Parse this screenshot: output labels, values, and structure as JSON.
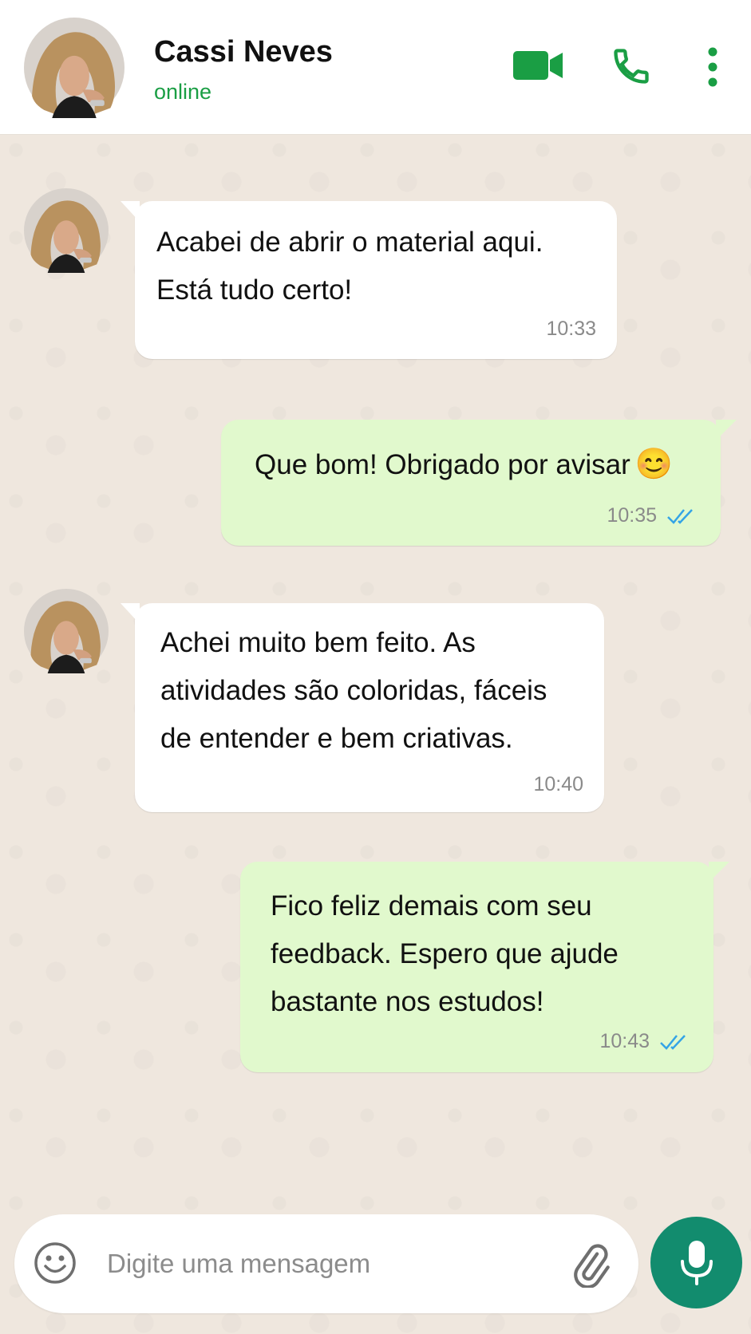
{
  "header": {
    "contact_name": "Cassi Neves",
    "status": "online",
    "accent_color": "#1a9e44",
    "icons": [
      "avatar",
      "video-call-icon",
      "voice-call-icon",
      "more-menu-icon"
    ]
  },
  "messages": [
    {
      "direction": "incoming",
      "lines": [
        "Acabei de abrir o material aqui.",
        "Está tudo certo!"
      ],
      "time": "10:33"
    },
    {
      "direction": "outgoing",
      "lines": [
        "Que bom! Obrigado por avisar"
      ],
      "emoji": "😊",
      "time": "10:35",
      "status": "read"
    },
    {
      "direction": "incoming",
      "lines": [
        "Achei muito bem feito. As",
        "atividades são coloridas, fáceis",
        "de entender e bem criativas."
      ],
      "time": "10:40"
    },
    {
      "direction": "outgoing",
      "lines": [
        "Fico feliz demais com seu",
        "feedback. Espero que ajude",
        "bastante nos estudos!"
      ],
      "time": "10:43",
      "status": "read"
    }
  ],
  "composer": {
    "placeholder": "Digite uma mensagem",
    "value": "",
    "send_button_color": "#128c6e",
    "icons": [
      "emoji-icon",
      "attach-icon",
      "mic-icon"
    ]
  },
  "colors": {
    "chat_background": "#efe7de",
    "incoming_bubble": "#ffffff",
    "outgoing_bubble": "#e1f9cd",
    "read_check": "#34a4e6"
  }
}
